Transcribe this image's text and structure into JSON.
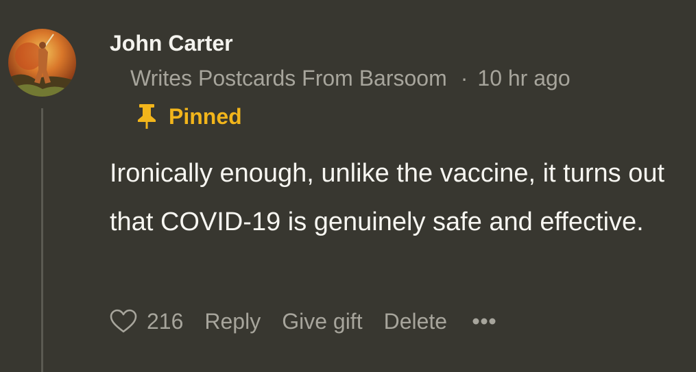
{
  "comment": {
    "author": "John Carter",
    "author_bio": "Writes Postcards From Barsoom",
    "separator": "·",
    "timestamp": "10 hr ago",
    "pinned_label": "Pinned",
    "text": "Ironically enough, unlike the vaccine, it turns out that COVID-19 is genuinely safe and effective.",
    "like_count": "216",
    "actions": {
      "reply": "Reply",
      "give_gift": "Give gift",
      "delete": "Delete"
    }
  },
  "icons": {
    "pin": "pushpin-icon",
    "like": "heart-icon",
    "more": "more-options-icon"
  },
  "colors": {
    "background": "#383730",
    "pinned_accent": "#f2b51b",
    "muted_text": "#a7a59c",
    "primary_text": "#f7f6f1"
  }
}
